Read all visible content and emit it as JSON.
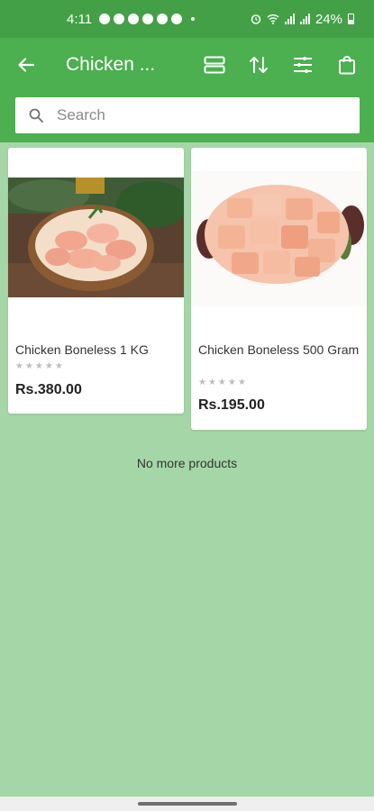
{
  "status_bar": {
    "time": "4:11",
    "battery": "24%"
  },
  "app_bar": {
    "title": "Chicken ...",
    "icons": [
      "back-arrow-icon",
      "list-view-icon",
      "sort-icon",
      "filter-icon",
      "shopping-bag-icon"
    ]
  },
  "search": {
    "placeholder": "Search",
    "value": ""
  },
  "products": [
    {
      "name": "Chicken Boneless 1 KG",
      "price": "Rs.380.00",
      "rating": 0
    },
    {
      "name": "Chicken Boneless 500 Gram",
      "price": "Rs.195.00",
      "rating": 0
    }
  ],
  "list_end_message": "No more products",
  "colors": {
    "status_bar": "#43a047",
    "app_bar": "#4caf50",
    "page_background": "#a5d6a7"
  }
}
